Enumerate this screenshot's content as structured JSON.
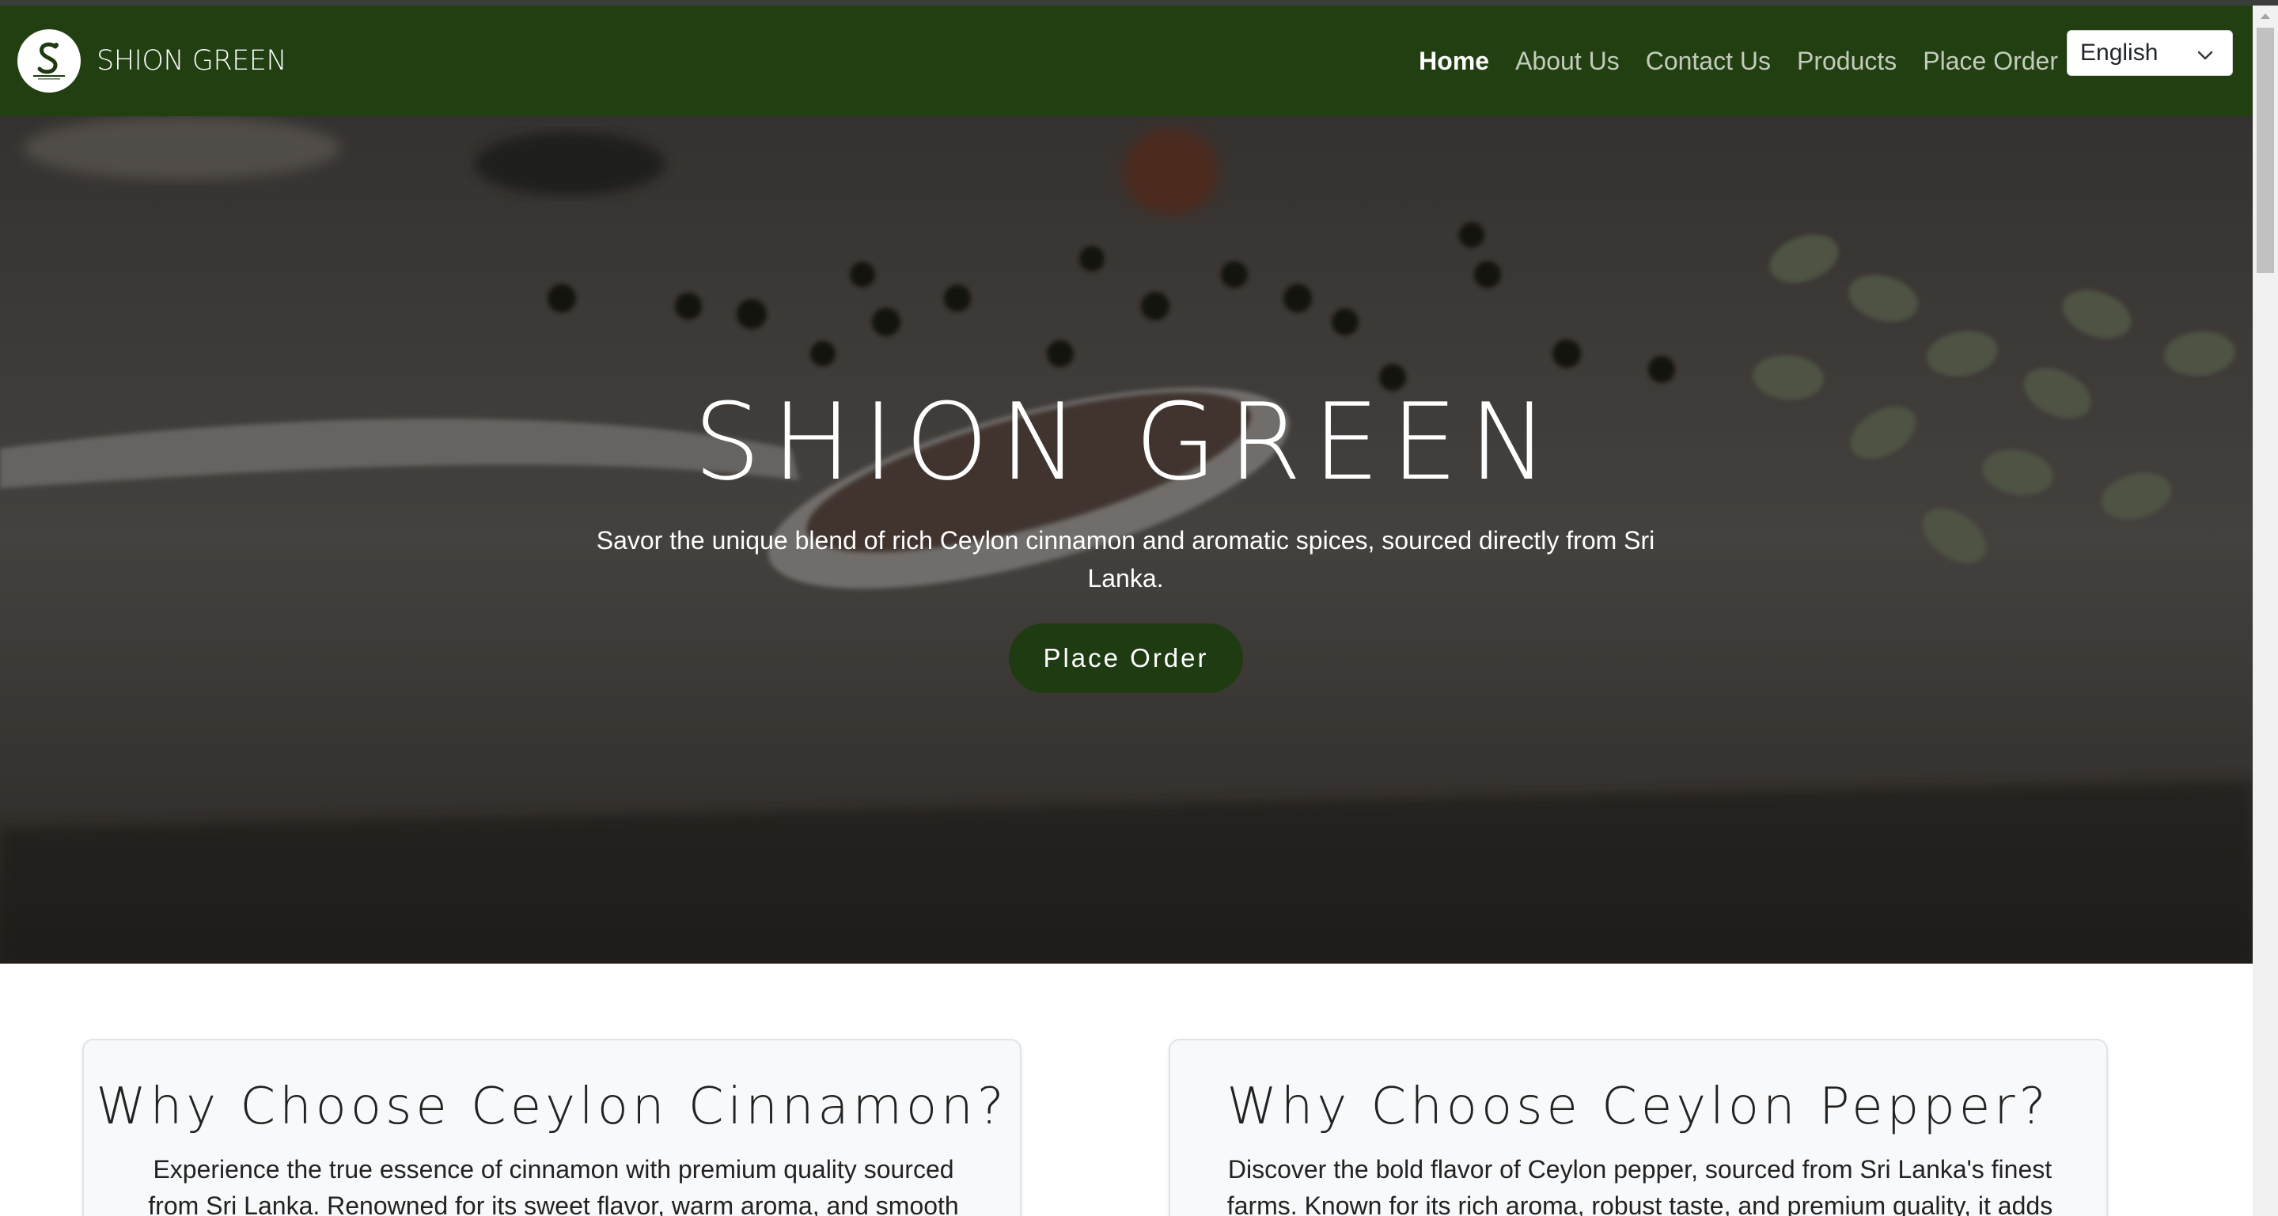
{
  "brand": {
    "name": "SHION GREEN",
    "logo_icon": "shion-green-logo-icon"
  },
  "nav": {
    "links": [
      {
        "label": "Home",
        "active": true
      },
      {
        "label": "About Us",
        "active": false
      },
      {
        "label": "Contact Us",
        "active": false
      },
      {
        "label": "Products",
        "active": false
      },
      {
        "label": "Place Order",
        "active": false
      }
    ],
    "language": {
      "selected": "English",
      "icon": "chevron-down-icon"
    }
  },
  "hero": {
    "title": "SHION GREEN",
    "subtitle": "Savor the unique blend of rich Ceylon cinnamon and aromatic spices, sourced directly from Sri Lanka.",
    "button_label": "Place Order"
  },
  "cards": [
    {
      "title": "Why Choose Ceylon Cinnamon?",
      "text": "Experience the true essence of cinnamon with premium quality sourced from Sri Lanka. Renowned for its sweet flavor, warm aroma, and smooth"
    },
    {
      "title": "Why Choose Ceylon Pepper?",
      "text": "Discover the bold flavor of Ceylon pepper, sourced from Sri Lanka's finest farms. Known for its rich aroma, robust taste, and premium quality, it adds"
    }
  ],
  "colors": {
    "navbar": "#223f12",
    "button": "#1e3b12",
    "nav_link": "#c3ccbb",
    "nav_active": "#ffffff"
  }
}
